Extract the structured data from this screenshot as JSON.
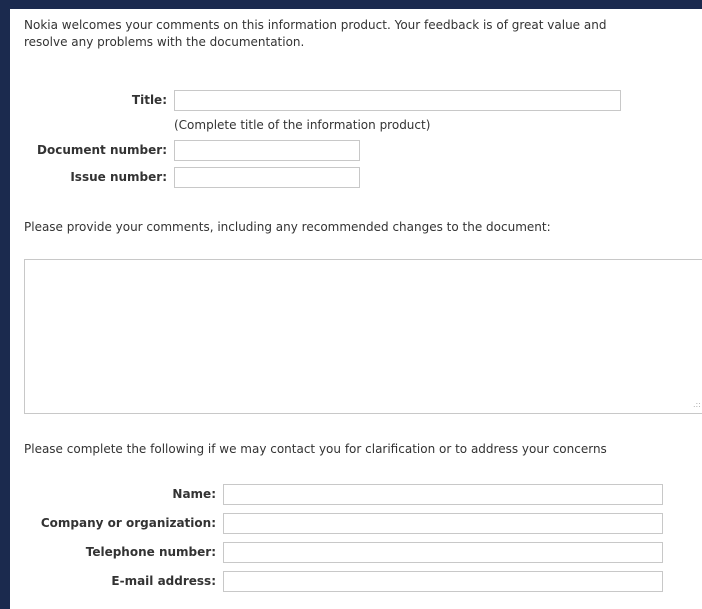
{
  "intro": {
    "line1": "Nokia welcomes your comments on this information product. Your feedback is of great value and",
    "line2": "resolve any problems with the documentation."
  },
  "document_fields": {
    "title_label": "Title:",
    "title_value": "",
    "title_hint": "(Complete title of the information product)",
    "document_number_label": "Document number:",
    "document_number_value": "",
    "issue_number_label": "Issue number:",
    "issue_number_value": ""
  },
  "comments": {
    "prompt": "Please provide your comments, including any recommended changes to the document:",
    "value": "",
    "resize_glyph": ".::"
  },
  "contact": {
    "prompt": "Please complete the following if we may contact you for clarification or to address your concerns",
    "name_label": "Name:",
    "name_value": "",
    "company_label": "Company or organization:",
    "company_value": "",
    "telephone_label": "Telephone number:",
    "telephone_value": "",
    "email_label": "E-mail address:",
    "email_value": ""
  }
}
